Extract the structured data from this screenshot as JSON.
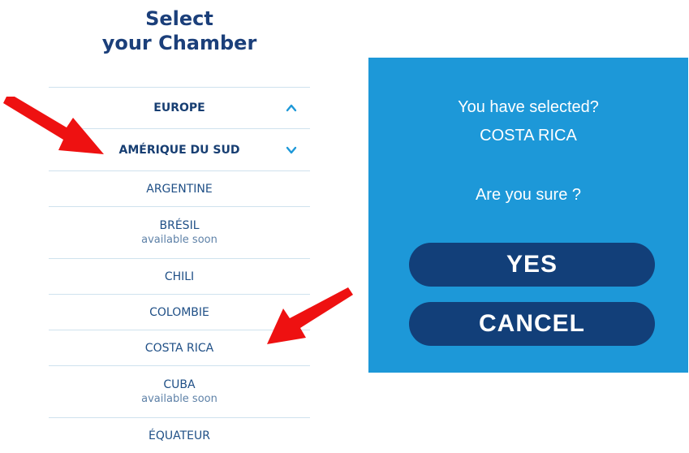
{
  "header": {
    "title_line1": "Select",
    "title_line2": "your Chamber"
  },
  "regions": [
    {
      "label": "EUROPE",
      "icon": "chevron-up-icon"
    },
    {
      "label": "AMÉRIQUE DU SUD",
      "icon": "chevron-down-icon"
    }
  ],
  "countries": [
    {
      "name": "ARGENTINE",
      "note": ""
    },
    {
      "name": "BRÉSIL",
      "note": "available soon"
    },
    {
      "name": "CHILI",
      "note": ""
    },
    {
      "name": "COLOMBIE",
      "note": ""
    },
    {
      "name": "COSTA RICA",
      "note": ""
    },
    {
      "name": "CUBA",
      "note": "available soon"
    },
    {
      "name": "ÉQUATEUR",
      "note": ""
    }
  ],
  "dialog": {
    "line1": "You have selected?",
    "line2": "COSTA RICA",
    "question": "Are you sure ?",
    "yes_label": "YES",
    "cancel_label": "CANCEL"
  },
  "colors": {
    "title": "#1b3f7a",
    "accent": "#1d98d8",
    "button": "#123f79",
    "annotation_arrow": "#ee1111"
  }
}
